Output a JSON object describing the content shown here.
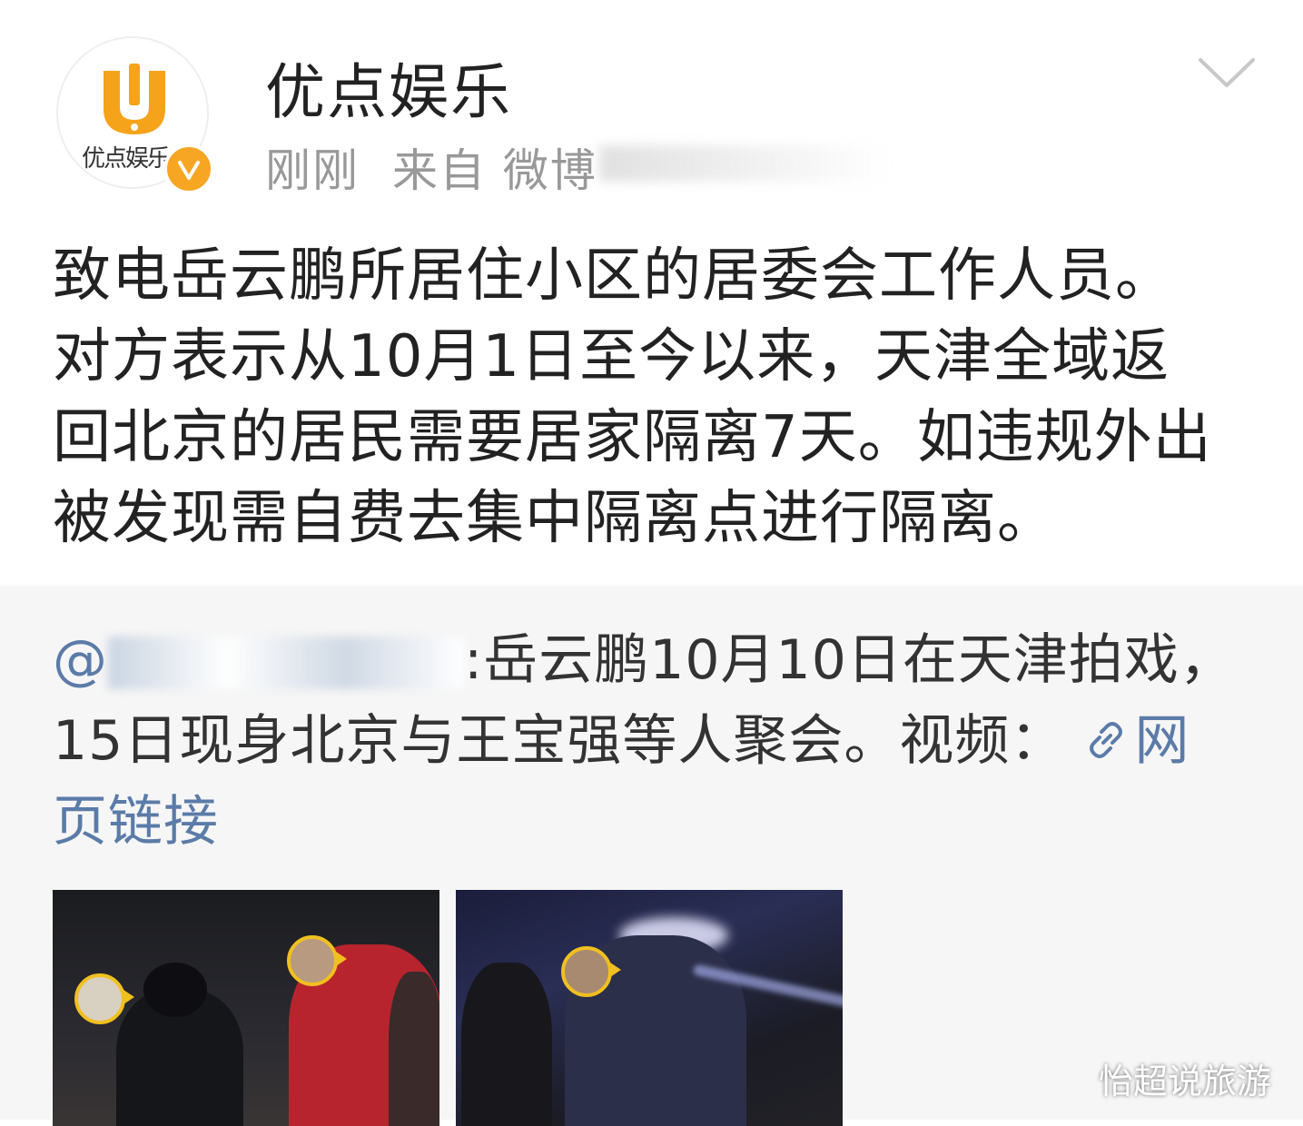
{
  "author": {
    "name": "优点娱乐",
    "avatar_logo_text": "优点娱乐",
    "verified_icon": "verified-badge-icon",
    "time": "刚刚",
    "source": "来自 微博"
  },
  "post": {
    "lines": [
      "致电岳云鹏所居住小区的居委会工作人员。",
      "对方表示从10月1日至今以来，天津全域返",
      "回北京的居民需要居家隔离7天。如违规外出",
      "被发现需自费去集中隔离点进行隔离。"
    ]
  },
  "repost": {
    "mention_prefix": "@",
    "line1_suffix": ":岳云鹏10月10日在天津拍戏，",
    "line2": "15日现身北京与王宝强等人聚会。视频：",
    "link_label_part1": "网",
    "link_label_part2": "页链接"
  },
  "watermark": "怡超说旅游",
  "colors": {
    "link": "#5b7ba8",
    "badge": "#f6a623",
    "logo": "#f5a31a"
  }
}
